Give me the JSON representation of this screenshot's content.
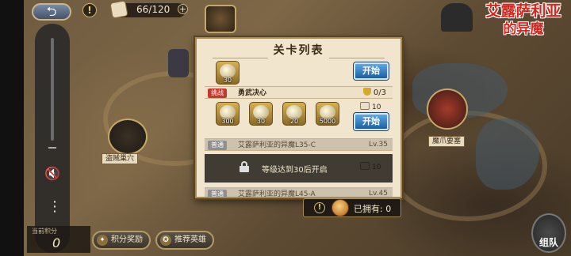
{
  "topbar": {
    "back_glyph": "⮌",
    "info_glyph": "!",
    "stamina": "66/120",
    "stamina_plus": "+"
  },
  "logo": {
    "line1": "艾露萨利亚",
    "line2": "的异魔"
  },
  "system_bar": {
    "mute_glyph": "🔇",
    "more_glyph": "⋮"
  },
  "map": {
    "markers": [
      {
        "label": "盗贼巢穴"
      },
      {
        "label": "魔爪要塞"
      }
    ]
  },
  "modal": {
    "title": "关卡列表",
    "stages": [
      {
        "partial_reward_count": "30",
        "start_label": "开始"
      },
      {
        "tag": "挑战",
        "name": "勇武决心",
        "progress": "0/3",
        "rewards": [
          {
            "icon": "gold-coin-icon",
            "count": "300"
          },
          {
            "icon": "feather-icon",
            "count": "30"
          },
          {
            "icon": "ring-icon",
            "count": "20"
          },
          {
            "icon": "gold-stack-icon",
            "count": "5000"
          }
        ],
        "cost": "10",
        "start_label": "开始"
      },
      {
        "tag": "普通",
        "name": "艾露萨利亚的异魔L35-C",
        "level": "Lv.35",
        "cost": "10",
        "locked_text": "等级达到30后开启"
      },
      {
        "tag": "普通",
        "name": "艾露萨利亚的异魔L45-A",
        "level": "Lv.45"
      }
    ]
  },
  "owned": {
    "info_glyph": "!",
    "text": "已拥有: 0"
  },
  "bottom": {
    "score_label": "当前积分",
    "score_value": "0",
    "rewards_button": "积分奖励",
    "heroes_button": "推荐英雄",
    "team_button": "组队"
  },
  "colors": {
    "start_button": "#2f7cc4",
    "challenge_tag": "#c2392f",
    "panel_bg": "#f1e6cd",
    "logo_red": "#d9251d"
  }
}
